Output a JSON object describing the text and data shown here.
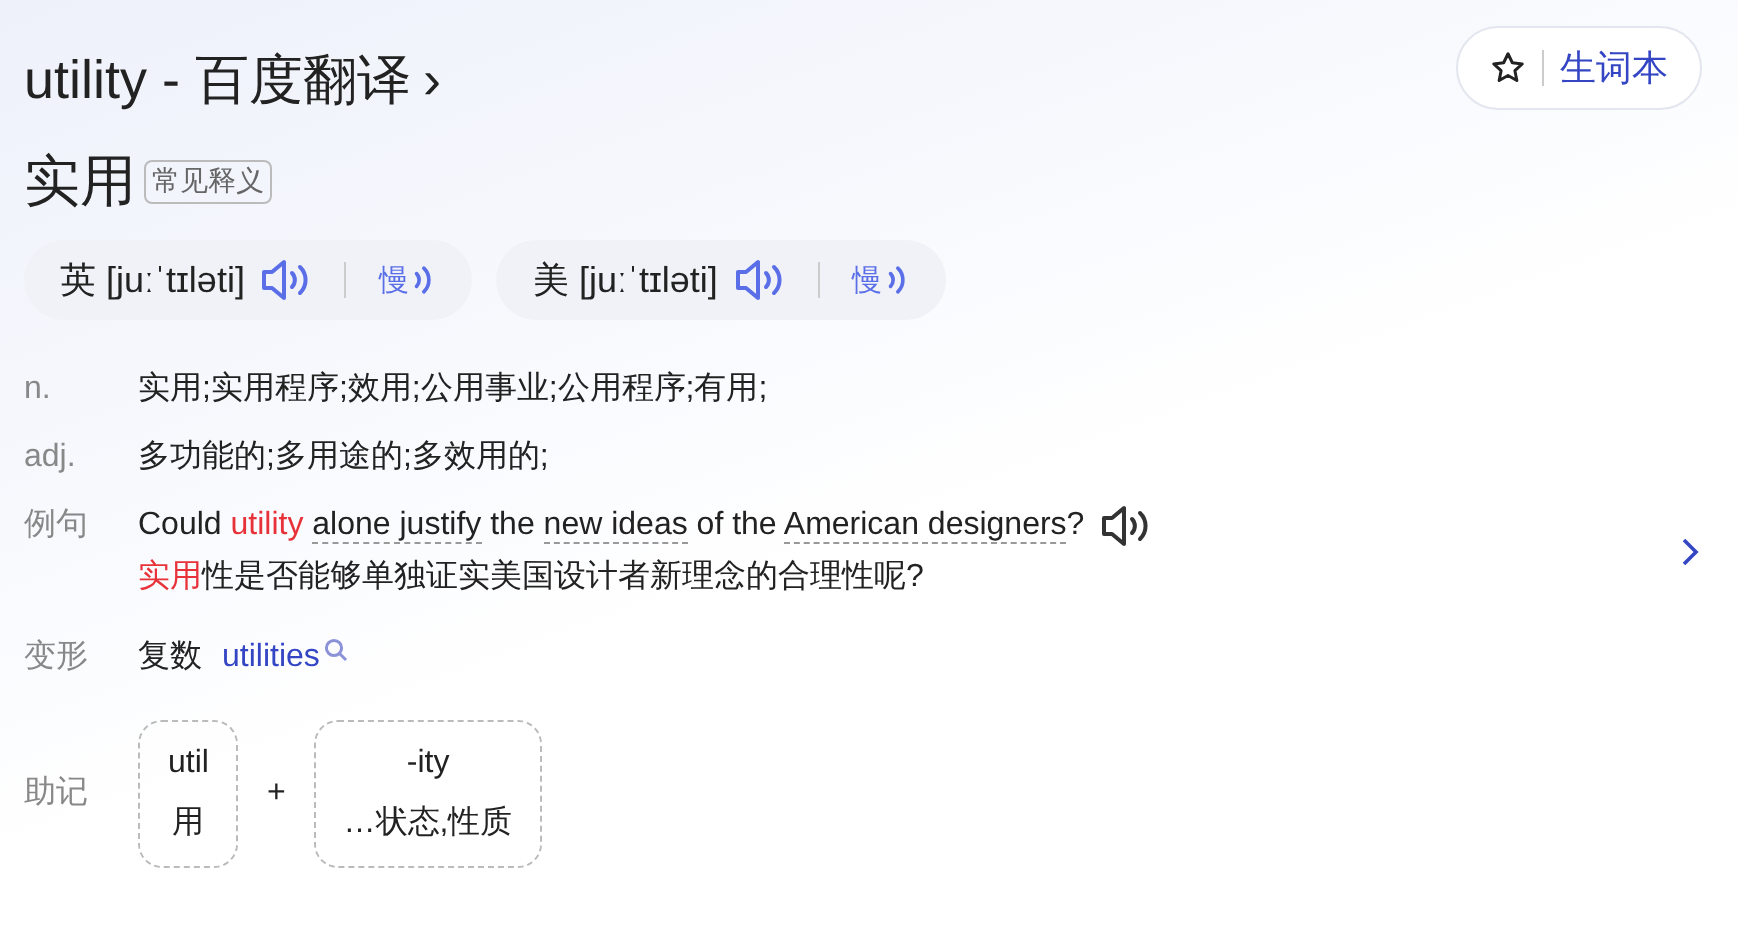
{
  "header": {
    "title": "utility - 百度翻译",
    "chevron": "›",
    "wordbook_button": "生词本"
  },
  "headword": {
    "text": "实用",
    "tag": "常见释义"
  },
  "pronunciations": [
    {
      "region": "英",
      "phonetic": "[juːˈtɪləti]",
      "slow_label": "慢"
    },
    {
      "region": "美",
      "phonetic": "[juːˈtɪləti]",
      "slow_label": "慢"
    }
  ],
  "definitions": [
    {
      "pos": "n.",
      "text": "实用;实用程序;效用;公用事业;公用程序;有用;"
    },
    {
      "pos": "adj.",
      "text": "多功能的;多用途的;多效用的;"
    }
  ],
  "example": {
    "label": "例句",
    "sentence": [
      {
        "kind": "plain",
        "text": "Could "
      },
      {
        "kind": "highlight",
        "text": "utility "
      },
      {
        "kind": "phrase",
        "text": "alone justify"
      },
      {
        "kind": "plain",
        "text": " the "
      },
      {
        "kind": "phrase",
        "text": "new ideas"
      },
      {
        "kind": "plain",
        "text": " of the "
      },
      {
        "kind": "phrase",
        "text": "American designers"
      },
      {
        "kind": "plain",
        "text": "?"
      }
    ],
    "translation": [
      {
        "kind": "highlight",
        "text": "实用"
      },
      {
        "kind": "plain",
        "text": "性是否能够单独证实美国设计者新理念的合理性呢?"
      }
    ]
  },
  "inflection": {
    "label": "变形",
    "type": "复数",
    "form": "utilities"
  },
  "mnemonic": {
    "label": "助记",
    "plus": "+",
    "parts": [
      {
        "root": "util",
        "meaning": "用"
      },
      {
        "root": "-ity",
        "meaning": "…状态,性质"
      }
    ]
  }
}
